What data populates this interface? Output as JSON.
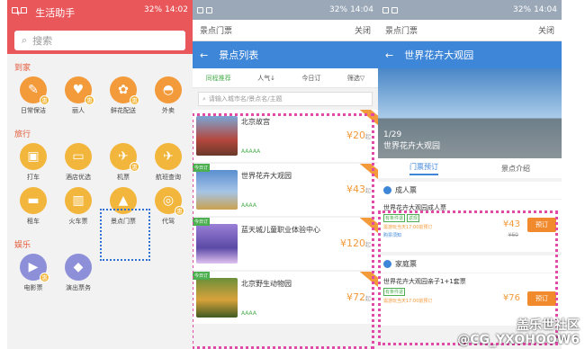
{
  "screen1": {
    "status": {
      "time": "14:02",
      "battery": "32%"
    },
    "header_title": "生活助手",
    "search_placeholder": "搜索",
    "sections": [
      {
        "title": "到家",
        "items": [
          {
            "label": "日常保洁",
            "icon": "broom-icon"
          },
          {
            "label": "丽人",
            "icon": "makeup-icon"
          },
          {
            "label": "鲜花配送",
            "icon": "flower-icon"
          },
          {
            "label": "外卖",
            "icon": "food-bowl-icon"
          }
        ]
      },
      {
        "title": "旅行",
        "items": [
          {
            "label": "打车",
            "icon": "taxi-icon"
          },
          {
            "label": "酒店优选",
            "icon": "hotel-bed-icon"
          },
          {
            "label": "机票",
            "icon": "plane-icon"
          },
          {
            "label": "航班查询",
            "icon": "flight-search-icon"
          },
          {
            "label": "租车",
            "icon": "car-icon"
          },
          {
            "label": "火车票",
            "icon": "train-icon"
          },
          {
            "label": "景点门票",
            "icon": "attraction-icon"
          },
          {
            "label": "代驾",
            "icon": "steering-wheel-icon"
          }
        ]
      },
      {
        "title": "娱乐",
        "items": [
          {
            "label": "电影票",
            "icon": "movie-icon"
          },
          {
            "label": "演出票务",
            "icon": "ticket-icon"
          }
        ]
      }
    ]
  },
  "screen2": {
    "status": {
      "time": "14:04",
      "battery": "32%"
    },
    "topbar_title": "景点门票",
    "topbar_close": "关闭",
    "header_title": "景点列表",
    "filters": [
      "同程推荐",
      "人气",
      "今日订",
      "筛选"
    ],
    "search_placeholder": "请输入城市名/景点名/主题",
    "list": [
      {
        "name": "北京故宫",
        "grade": "AAAAA",
        "price": "¥20",
        "unit": "起",
        "today": ""
      },
      {
        "name": "世界花卉大观园",
        "grade": "AAAA",
        "price": "¥43",
        "unit": "起",
        "today": "今日订"
      },
      {
        "name": "蓝天城儿童职业体验中心",
        "grade": "",
        "price": "¥120",
        "unit": "起",
        "today": "今日订"
      },
      {
        "name": "北京野生动物园",
        "grade": "AAAA",
        "price": "¥72",
        "unit": "起",
        "today": "今日订"
      }
    ]
  },
  "screen3": {
    "status": {
      "time": "14:04",
      "battery": "32%"
    },
    "topbar_title": "景点门票",
    "topbar_close": "关闭",
    "header_title": "世界花卉大观园",
    "hero_caption": "世界花卉大观园",
    "hero_count": "1/29",
    "tabs": [
      "门票预订",
      "景点介绍"
    ],
    "sections": [
      {
        "title": "成人票",
        "item": {
          "name": "世界花卉大观园成人票",
          "tags": [
            "有条件退",
            "返现"
          ],
          "note": "需游玩当天17:00前预订",
          "link": "购票须知",
          "price": "¥43",
          "old_price": "¥60",
          "button": "预订",
          "sub": "在线支付"
        }
      },
      {
        "title": "家庭票",
        "item": {
          "name": "世界花卉大观园亲子1+1套票",
          "tags": [
            "有条件退"
          ],
          "note": "需游玩当天17:00前预订",
          "link": "",
          "price": "¥76",
          "old_price": "",
          "button": "预订",
          "sub": ""
        }
      }
    ]
  },
  "watermark": {
    "line1": "盖乐世社区",
    "line2": "@CG_YXOHOOW6"
  }
}
